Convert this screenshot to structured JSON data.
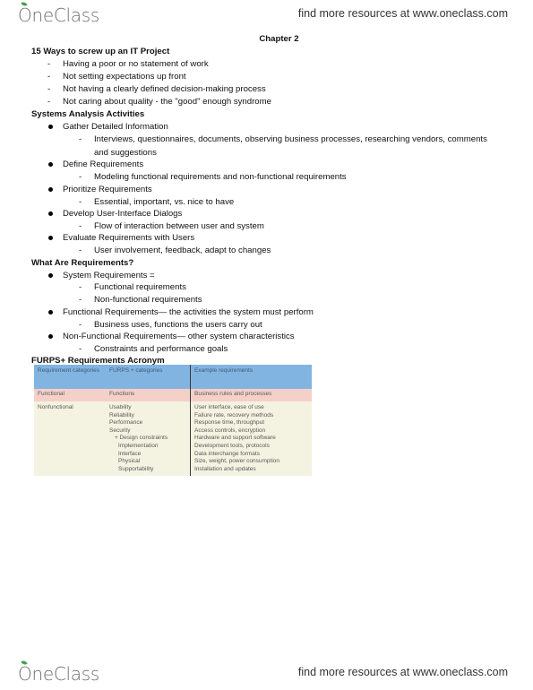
{
  "header": {
    "brand": "OneClass",
    "tagline": "find more resources at www.oneclass.com"
  },
  "footer": {
    "brand": "OneClass",
    "tagline": "find more resources at www.oneclass.com"
  },
  "document": {
    "chapter_title": "Chapter 2",
    "section1": {
      "heading": "15 Ways to screw up an IT Project",
      "items": [
        "Having a poor or no statement of work",
        "Not setting expectations up front",
        "Not having a clearly defined decision-making process",
        "Not caring about quality - the \"good\" enough syndrome"
      ]
    },
    "section2": {
      "heading": "Systems Analysis Activities",
      "items": [
        {
          "label": "Gather Detailed Information",
          "sub": [
            "Interviews, questionnaires, documents, observing business processes, researching vendors, comments",
            "and suggestions"
          ]
        },
        {
          "label": "Define Requirements",
          "sub": [
            "Modeling functional requirements and non-functional requirements"
          ]
        },
        {
          "label": "Prioritize Requirements",
          "sub": [
            "Essential, important, vs. nice to have"
          ]
        },
        {
          "label": "Develop User-Interface Dialogs",
          "sub": [
            "Flow of interaction between user and system"
          ]
        },
        {
          "label": "Evaluate Requirements with Users",
          "sub": [
            "User involvement, feedback, adapt to changes"
          ]
        }
      ]
    },
    "section3": {
      "heading": "What Are Requirements?",
      "items": [
        {
          "label": "System Requirements =",
          "sub": [
            "Functional requirements",
            "Non-functional requirements"
          ]
        },
        {
          "label": "Functional Requirements— the activities the system must perform",
          "sub": [
            "Business uses, functions the users carry out"
          ]
        },
        {
          "label": "Non-Functional Requirements— other system characteristics",
          "sub": [
            "Constraints and performance goals"
          ]
        }
      ]
    },
    "section4": {
      "heading": "FURPS+ Requirements Acronym",
      "table": {
        "headers": [
          "Requirement categories",
          "FURPS + categories",
          "Example requirements"
        ],
        "functional": {
          "category": "Functional",
          "furps": "Functions",
          "example": "Business rules and processes"
        },
        "nonfunctional": {
          "category": "Nonfunctional",
          "furps": [
            "Usability",
            "Reliability",
            "Performance",
            "Security",
            "+ Design constraints",
            "Implementation",
            "Interface",
            "Physical",
            "Supportability"
          ],
          "examples": [
            "User interface, ease of use",
            "Failure rate, recovery methods",
            "Response time, throughput",
            "Access controls, encryption",
            "Hardware and support software",
            "Development tools, protocols",
            "Data interchange formats",
            "Size, weight, power consumption",
            "Installation and updates"
          ]
        }
      }
    }
  },
  "colors": {
    "table_header": "#82b4e1",
    "table_functional_row": "#f4d0c8",
    "table_nonfunctional_row": "#f4f2e0",
    "brand_leaf": "#3ea34a"
  }
}
